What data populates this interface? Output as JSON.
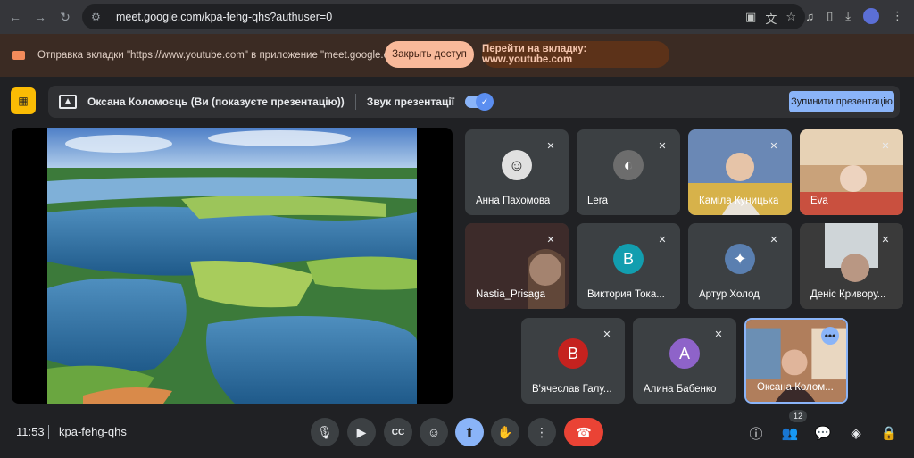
{
  "browser": {
    "url": "meet.google.com/kpa-fehg-qhs?authuser=0"
  },
  "notification": {
    "text": "Отправка вкладки \"https://www.youtube.com\" в приложение \"meet.google.com\"...",
    "stop_label": "Закрыть доступ",
    "goto_label": "Перейти на вкладку: www.youtube.com"
  },
  "presenting": {
    "name": "Оксана Коломоєць (Ви (показуєте презентацію))",
    "sound_label": "Звук презентації",
    "sound_on": true,
    "stop_label": "Зупинити презентацію"
  },
  "participants": [
    {
      "name": "Анна Пахомова",
      "avatar": "photo",
      "muted": true
    },
    {
      "name": "Lera",
      "avatar": "photo",
      "muted": true
    },
    {
      "name": "Каміла Куницька",
      "avatar": "video",
      "muted": true
    },
    {
      "name": "Eva",
      "avatar": "video",
      "muted": true
    },
    {
      "name": "Nastia_Prisaga",
      "avatar": "video",
      "muted": true
    },
    {
      "name": "Виктория Тока...",
      "avatar": "letter",
      "letter": "В",
      "color": "#129eaf",
      "muted": true
    },
    {
      "name": "Артур Холод",
      "avatar": "photo",
      "muted": true
    },
    {
      "name": "Деніс Кривору...",
      "avatar": "video",
      "muted": true
    },
    {
      "name": "В'ячеслав Галу...",
      "avatar": "letter",
      "letter": "В",
      "color": "#c5221f",
      "muted": true
    },
    {
      "name": "Алина Бабенко",
      "avatar": "letter",
      "letter": "А",
      "color": "#8e63c9",
      "muted": true
    },
    {
      "name": "Оксана Колом...",
      "avatar": "video",
      "muted": false,
      "self": true
    }
  ],
  "meeting": {
    "time": "11:53",
    "code": "kpa-fehg-qhs",
    "participant_count": "12"
  },
  "colors": {
    "accent": "#8ab4f8",
    "leave": "#ea4335",
    "present_badge": "#fbbc04"
  }
}
